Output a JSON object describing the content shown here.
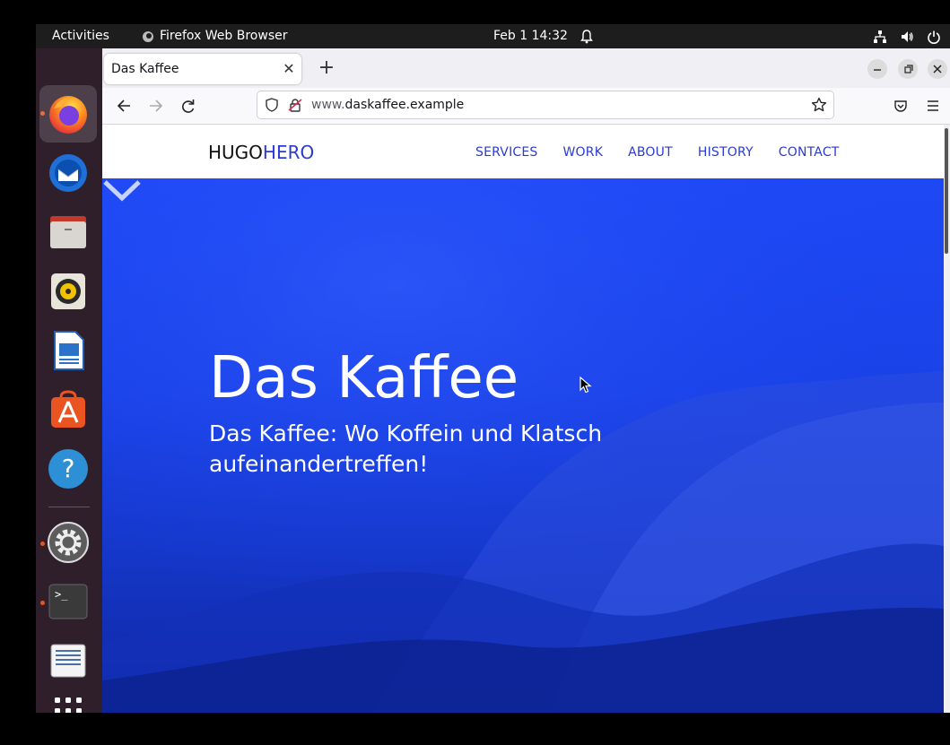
{
  "topbar": {
    "activities": "Activities",
    "app_name": "Firefox Web Browser",
    "clock": "Feb 1  14:32"
  },
  "dock": {
    "items": [
      "firefox",
      "thunderbird",
      "files",
      "rhythmbox",
      "libreoffice-writer",
      "app-center",
      "help",
      "settings",
      "terminal",
      "text-editor",
      "show-apps"
    ]
  },
  "browser": {
    "tab_title": "Das Kaffee",
    "url_prefix": "www.",
    "url_domain": "daskaffee.example"
  },
  "site": {
    "logo_part1": "HUGO",
    "logo_part2": "HERO",
    "nav": [
      "SERVICES",
      "WORK",
      "ABOUT",
      "HISTORY",
      "CONTACT"
    ],
    "hero_title": "Das Kaffee",
    "hero_subtitle": "Das Kaffee: Wo Koffein und Klatsch aufeinandertreffen!"
  },
  "colors": {
    "accent": "#2a3bd1",
    "hero": "#1d48f5",
    "dock": "#2f1f2b",
    "topbar": "#1d1d1d",
    "ubuntu_orange": "#e95420"
  }
}
